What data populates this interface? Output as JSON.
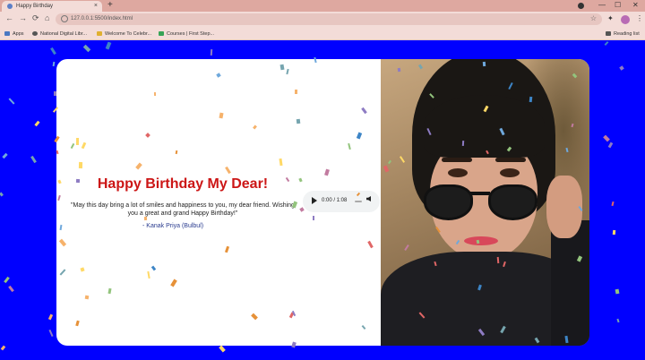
{
  "browser": {
    "tab_title": "Happy Birthday",
    "tab_close": "×",
    "new_tab": "+",
    "minimize": "—",
    "maximize": "☐",
    "close": "✕",
    "url": "127.0.0.1:5500/index.html",
    "bookmarks": [
      {
        "label": "Apps",
        "icon": "apps-grid-icon",
        "color": "#4a78c2"
      },
      {
        "label": "National Digital Libr...",
        "icon": "library-icon",
        "color": "#555555"
      },
      {
        "label": "Welcome To Celebr...",
        "icon": "folder-icon",
        "color": "#e0b030"
      },
      {
        "label": "Courses | First Step...",
        "icon": "courses-icon",
        "color": "#36a356"
      }
    ],
    "reading_list": "Reading list"
  },
  "page": {
    "title": "Happy Birthday My Dear!",
    "message": "\"May this day bring a lot of smiles and happiness to you, my dear friend. Wishing you a great and grand Happy Birthday!\"",
    "signature": "- Kanak Priya (Bulbul)",
    "audio": {
      "time": "0:00 / 1:08",
      "progress": 0.0
    },
    "colors": {
      "background": "#0000ff",
      "title": "#cc1616",
      "signature": "#2a3c8f"
    }
  }
}
